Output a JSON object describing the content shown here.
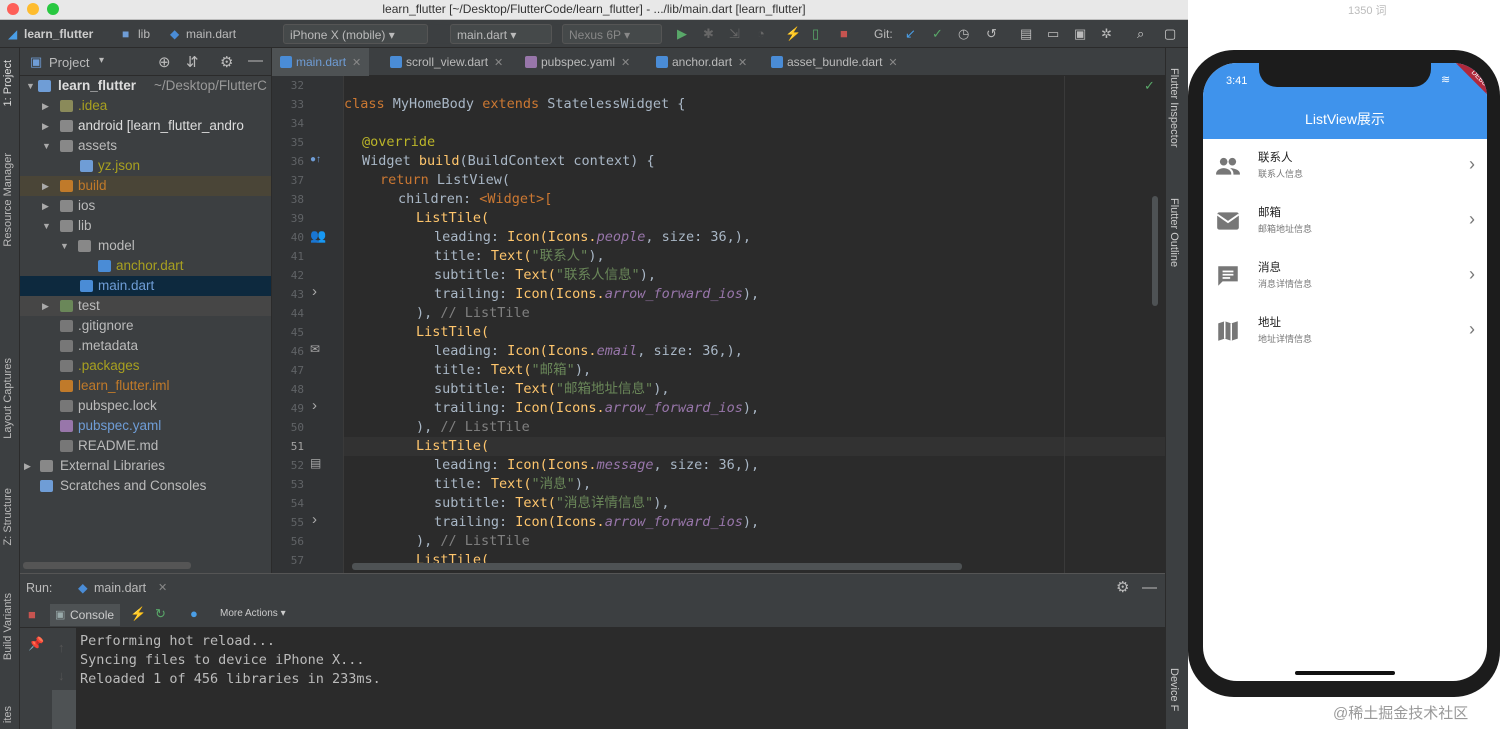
{
  "window": {
    "title": "learn_flutter [~/Desktop/FlutterCode/learn_flutter] - .../lib/main.dart [learn_flutter]"
  },
  "overlay": {
    "word_count": "1350 词",
    "watermark": "@稀土掘金技术社区"
  },
  "toolbar": {
    "project": "learn_flutter",
    "lib": "lib",
    "file": "main.dart",
    "device": "iPhone X (mobile)",
    "config": "main.dart",
    "emulator": "Nexus 6P",
    "git": "Git:"
  },
  "left_strip": {
    "project": "1: Project",
    "resource_manager": "Resource Manager",
    "layout_captures": "Layout Captures",
    "structure": "Z: Structure",
    "build_variants": "Build Variants",
    "favorites": "ites"
  },
  "right_strip": {
    "inspector": "Flutter Inspector",
    "outline": "Flutter Outline",
    "device": "Device F"
  },
  "project_panel": {
    "header": "Project",
    "root_path": "~/Desktop/FlutterC",
    "tree": [
      {
        "label": "learn_flutter"
      },
      {
        "label": ".idea"
      },
      {
        "label": "android [learn_flutter_andro"
      },
      {
        "label": "assets"
      },
      {
        "label": "yz.json"
      },
      {
        "label": "build"
      },
      {
        "label": "ios"
      },
      {
        "label": "lib"
      },
      {
        "label": "model"
      },
      {
        "label": "anchor.dart"
      },
      {
        "label": "main.dart"
      },
      {
        "label": "test"
      },
      {
        "label": ".gitignore"
      },
      {
        "label": ".metadata"
      },
      {
        "label": ".packages"
      },
      {
        "label": "learn_flutter.iml"
      },
      {
        "label": "pubspec.lock"
      },
      {
        "label": "pubspec.yaml"
      },
      {
        "label": "README.md"
      },
      {
        "label": "External Libraries"
      },
      {
        "label": "Scratches and Consoles"
      }
    ]
  },
  "editor_tabs": [
    "main.dart",
    "scroll_view.dart",
    "pubspec.yaml",
    "anchor.dart",
    "asset_bundle.dart"
  ],
  "code": {
    "lines": [
      "32",
      "33",
      "34",
      "35",
      "36",
      "37",
      "38",
      "39",
      "40",
      "41",
      "42",
      "43",
      "44",
      "45",
      "46",
      "47",
      "48",
      "49",
      "50",
      "51",
      "52",
      "53",
      "54",
      "55",
      "56",
      "57"
    ],
    "l33_kw": "class",
    "l33_name": " MyHomeBody ",
    "l33_ext": "extends",
    "l33_rest": " StatelessWidget {",
    "l35": "@override",
    "l36_a": "Widget ",
    "l36_fn": "build",
    "l36_b": "(BuildContext context) {",
    "l37_kw": "return",
    "l37_b": " ListView(",
    "l38_a": "children: ",
    "l38_b": "<Widget>[",
    "listtile": "ListTile(",
    "leading": "leading: ",
    "icon": "Icon(Icons.",
    "size": ", size: 36,),",
    "title": "title: ",
    "text_open": "Text(",
    "subtitle": "subtitle: ",
    "trailing": "trailing: ",
    "arrow": "arrow_forward_ios",
    "close_paren": "),",
    "close_item": "),",
    "comment": " // ListTile",
    "tiles": [
      {
        "icon": "people",
        "title": "\"联系人\"",
        "subtitle": "\"联系人信息\""
      },
      {
        "icon": "email",
        "title": "\"邮箱\"",
        "subtitle": "\"邮箱地址信息\""
      },
      {
        "icon": "message",
        "title": "\"消息\"",
        "subtitle": "\"消息详情信息\""
      }
    ],
    "l57": "ListTile("
  },
  "run": {
    "label": "Run:",
    "tab": "main.dart",
    "console_tab": "Console",
    "more_actions": "More Actions",
    "output": "Performing hot reload...\nSyncing files to device iPhone X...\nReloaded 1 of 456 libraries in 233ms."
  },
  "phone": {
    "time": "3:41",
    "appbar_title": "ListView展示",
    "debug_badge": "DEBUG",
    "items": [
      {
        "title": "联系人",
        "subtitle": "联系人信息",
        "icon": "people-icon"
      },
      {
        "title": "邮箱",
        "subtitle": "邮箱地址信息",
        "icon": "email-icon"
      },
      {
        "title": "消息",
        "subtitle": "消息详情信息",
        "icon": "message-icon"
      },
      {
        "title": "地址",
        "subtitle": "地址详情信息",
        "icon": "map-icon"
      }
    ],
    "trailing_glyph": "›"
  }
}
